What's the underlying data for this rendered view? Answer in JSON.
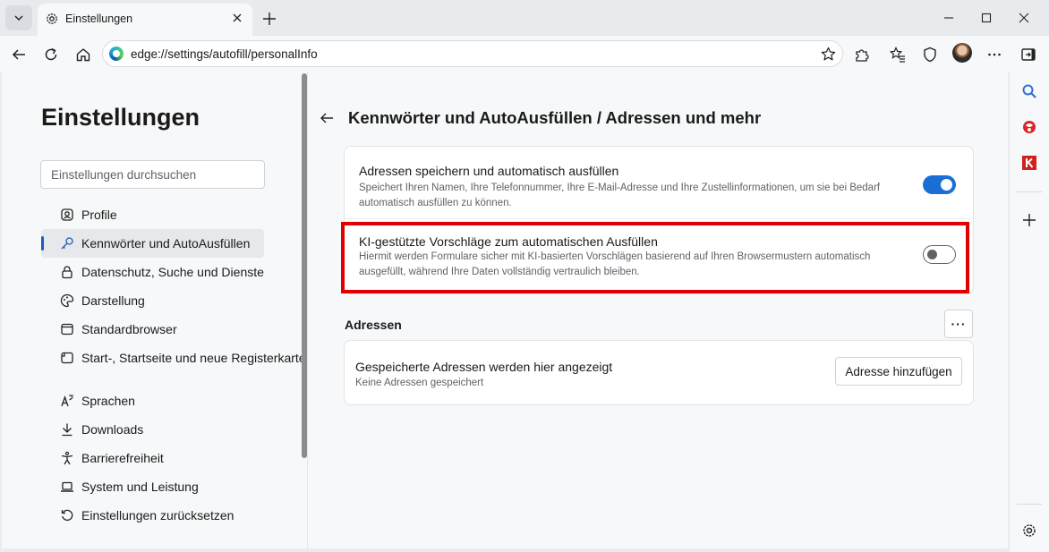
{
  "browser": {
    "tab_title": "Einstellungen",
    "url": "edge://settings/autofill/personalInfo"
  },
  "settings": {
    "title": "Einstellungen",
    "search_placeholder": "Einstellungen durchsuchen",
    "nav_items": [
      {
        "label": "Profile",
        "icon": "profile-icon"
      },
      {
        "label": "Kennwörter und AutoAusfüllen",
        "icon": "key-icon",
        "active": true
      },
      {
        "label": "Datenschutz, Suche und Dienste",
        "icon": "lock-icon"
      },
      {
        "label": "Darstellung",
        "icon": "palette-icon"
      },
      {
        "label": "Standardbrowser",
        "icon": "browser-window-icon"
      },
      {
        "label": "Start-, Startseite und neue Registerkarten",
        "icon": "home-tab-icon"
      },
      {
        "label": "Sprachen",
        "icon": "language-icon"
      },
      {
        "label": "Downloads",
        "icon": "download-icon"
      },
      {
        "label": "Barrierefreiheit",
        "icon": "accessibility-icon"
      },
      {
        "label": "System und Leistung",
        "icon": "laptop-icon"
      },
      {
        "label": "Einstellungen zurücksetzen",
        "icon": "reset-icon"
      }
    ]
  },
  "page": {
    "heading": "Kennwörter und AutoAusfüllen / Adressen und mehr",
    "toggle_settings": [
      {
        "title": "Adressen speichern und automatisch ausfüllen",
        "description": "Speichert Ihren Namen, Ihre Telefonnummer, Ihre E-Mail-Adresse und Ihre Zustellinformationen, um sie bei Bedarf automatisch ausfüllen zu können.",
        "enabled": true
      },
      {
        "title": "KI-gestützte Vorschläge zum automatischen Ausfüllen",
        "description": "Hiermit werden Formulare sicher mit KI-basierten Vorschlägen basierend auf Ihren Browsermustern automatisch ausgefüllt, während Ihre Daten vollständig vertraulich bleiben.",
        "enabled": false
      }
    ],
    "addresses": {
      "section_label": "Adressen",
      "more_label": "···",
      "card_title": "Gespeicherte Adressen werden hier angezeigt",
      "card_subtitle": "Keine Adressen gespeichert",
      "add_button": "Adresse hinzufügen"
    }
  },
  "colors": {
    "accent": "#1a6fd6",
    "highlight_frame": "#e00000"
  }
}
